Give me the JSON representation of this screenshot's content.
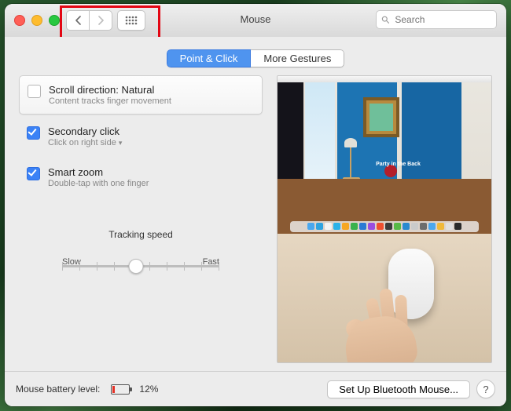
{
  "window": {
    "title": "Mouse"
  },
  "search": {
    "placeholder": "Search"
  },
  "tabs": [
    {
      "label": "Point & Click",
      "active": true
    },
    {
      "label": "More Gestures",
      "active": false
    }
  ],
  "options": {
    "scroll": {
      "title": "Scroll direction: Natural",
      "subtitle": "Content tracks finger movement",
      "checked": false
    },
    "secondary": {
      "title": "Secondary click",
      "subtitle": "Click on right side",
      "checked": true
    },
    "smartzoom": {
      "title": "Smart zoom",
      "subtitle": "Double-tap with one finger",
      "checked": true
    }
  },
  "tracking": {
    "label": "Tracking speed",
    "min_label": "Slow",
    "max_label": "Fast",
    "value": 5,
    "ticks": 10
  },
  "preview": {
    "caption": "Party in the Back",
    "dock_colors": [
      "#4aa7ef",
      "#2fa3e0",
      "#f3f3f3",
      "#2bb2e9",
      "#f6a623",
      "#38b24d",
      "#2a7ad4",
      "#9a4de0",
      "#f05030",
      "#3c3c3c",
      "#58b947",
      "#2a8ad0",
      "#cacaca",
      "#6d6d6d",
      "#4aa7ef",
      "#f0b93a",
      "#e0e0e0",
      "#2a2a2a"
    ]
  },
  "footer": {
    "battery_label": "Mouse battery level:",
    "battery_pct": "12%",
    "setup_label": "Set Up Bluetooth Mouse...",
    "help": "?"
  }
}
